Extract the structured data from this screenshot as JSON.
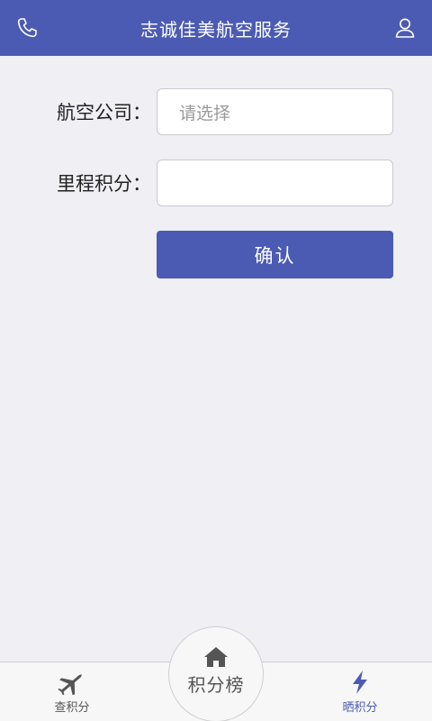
{
  "header": {
    "title": "志诚佳美航空服务",
    "left_icon": "phone-icon",
    "right_icon": "user-icon"
  },
  "form": {
    "airline_label": "航空公司：",
    "airline_placeholder": "请选择",
    "mileage_label": "里程积分：",
    "mileage_value": "",
    "confirm_label": "确认"
  },
  "tabbar": {
    "left": {
      "label": "查积分",
      "icon": "airplane-icon"
    },
    "center": {
      "label": "积分榜",
      "icon": "home-icon"
    },
    "right": {
      "label": "晒积分",
      "icon": "lightning-icon"
    }
  },
  "colors": {
    "primary": "#4b5bb3",
    "background": "#efeff4",
    "tabbar_bg": "#f7f7f7"
  }
}
